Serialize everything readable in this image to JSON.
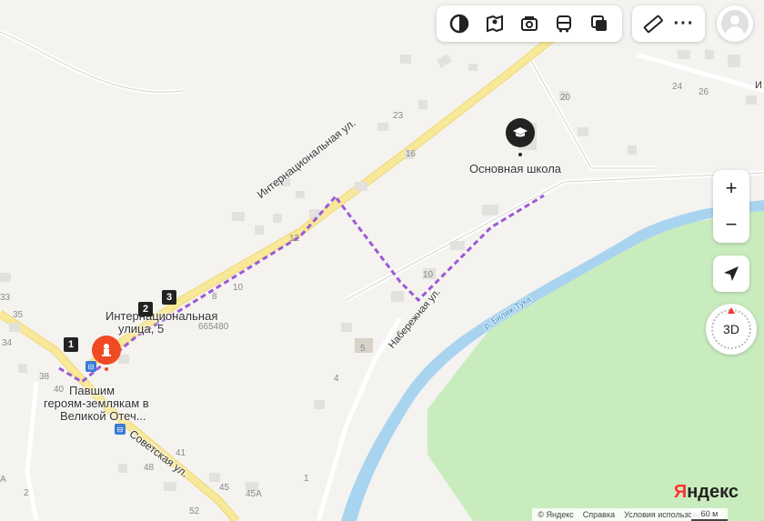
{
  "toolbar": {
    "items": [
      {
        "name": "layers-icon",
        "label": ""
      },
      {
        "name": "panorama-icon",
        "label": ""
      },
      {
        "name": "photo-icon",
        "label": ""
      },
      {
        "name": "transit-icon",
        "label": ""
      },
      {
        "name": "map-layers-icon",
        "label": ""
      }
    ],
    "ruler": "ruler-icon",
    "more": "more-icon",
    "profile": "avatar"
  },
  "controls": {
    "zoom_in": "+",
    "zoom_out": "−",
    "locate": "location-arrow-icon",
    "view3d": "3D"
  },
  "places": {
    "school": "Основная школа",
    "address_line1": "Интернациональная",
    "address_line2": "улица, 5",
    "memorial_line1": "Павшим",
    "memorial_line2": "героям-землякам в",
    "memorial_line3": "Великой Отеч..."
  },
  "streets": {
    "internatsionalnaya": "Интернациональная ул.",
    "naberezhnaya": "Набережная ул.",
    "sovetskaya": "Советская ул.",
    "river": "р. Билиж-Тука",
    "ul_cut": "И"
  },
  "postcode": "665480",
  "house_numbers": [
    "23",
    "16",
    "12",
    "10",
    "8",
    "10",
    "5",
    "4",
    "20",
    "24",
    "26",
    "35",
    "34",
    "33",
    "38",
    "40",
    "41",
    "48",
    "45",
    "45А",
    "52",
    "2",
    "1",
    "А"
  ],
  "stops": [
    "1",
    "2",
    "3"
  ],
  "footer": {
    "copyright": "© Яндекс",
    "help": "Справка",
    "terms": "Условия использования",
    "scale": "60 м"
  },
  "logo": {
    "first": "Я",
    "rest": "ндекс"
  },
  "colors": {
    "route": "#9b59d6",
    "pin": "#f04a23",
    "river": "#a9d4f0",
    "forest": "#c9ecbe",
    "road": "#f8e89a"
  }
}
